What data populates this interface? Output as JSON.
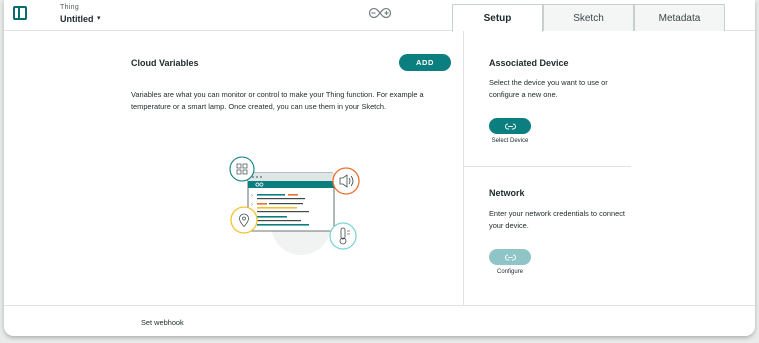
{
  "header": {
    "thing_label": "Thing",
    "thing_name": "Untitled",
    "caret": "▾",
    "tabs": [
      {
        "label": "Setup",
        "active": true
      },
      {
        "label": "Sketch",
        "active": false
      },
      {
        "label": "Metadata",
        "active": false
      }
    ]
  },
  "cloud_variables": {
    "title": "Cloud Variables",
    "add_label": "ADD",
    "description": "Variables are what you can monitor or control to make your Thing function. For example a temperature or a smart lamp. Once created, you can use them in your Sketch."
  },
  "associated_device": {
    "title": "Associated Device",
    "description": "Select the device you want to use or configure a new one.",
    "button_label": "Select Device"
  },
  "network": {
    "title": "Network",
    "description": "Enter your network credentials to connect your device.",
    "button_label": "Configure"
  },
  "footer": {
    "webhook_label": "Set webhook"
  },
  "colors": {
    "accent": "#0b7e80",
    "accent_disabled": "#8fc5c6",
    "orange": "#e8712e",
    "yellow": "#f2c12e",
    "teal_light": "#7fd3d6"
  }
}
